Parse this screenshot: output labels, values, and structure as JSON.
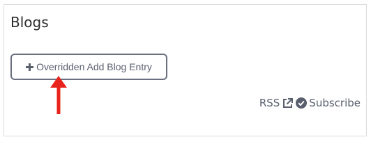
{
  "panel": {
    "title": "Blogs"
  },
  "actions": {
    "add_blog_entry_label": "Overridden Add Blog Entry"
  },
  "footer": {
    "rss_label": "RSS",
    "subscribe_label": "Subscribe"
  },
  "icons": {
    "add": "plus-icon",
    "external": "external-link-icon",
    "check": "check-circle-icon",
    "pointer": "red-arrow-pointer-icon"
  },
  "colors": {
    "arrow": "#e8231b",
    "text": "#5a5f6e"
  }
}
